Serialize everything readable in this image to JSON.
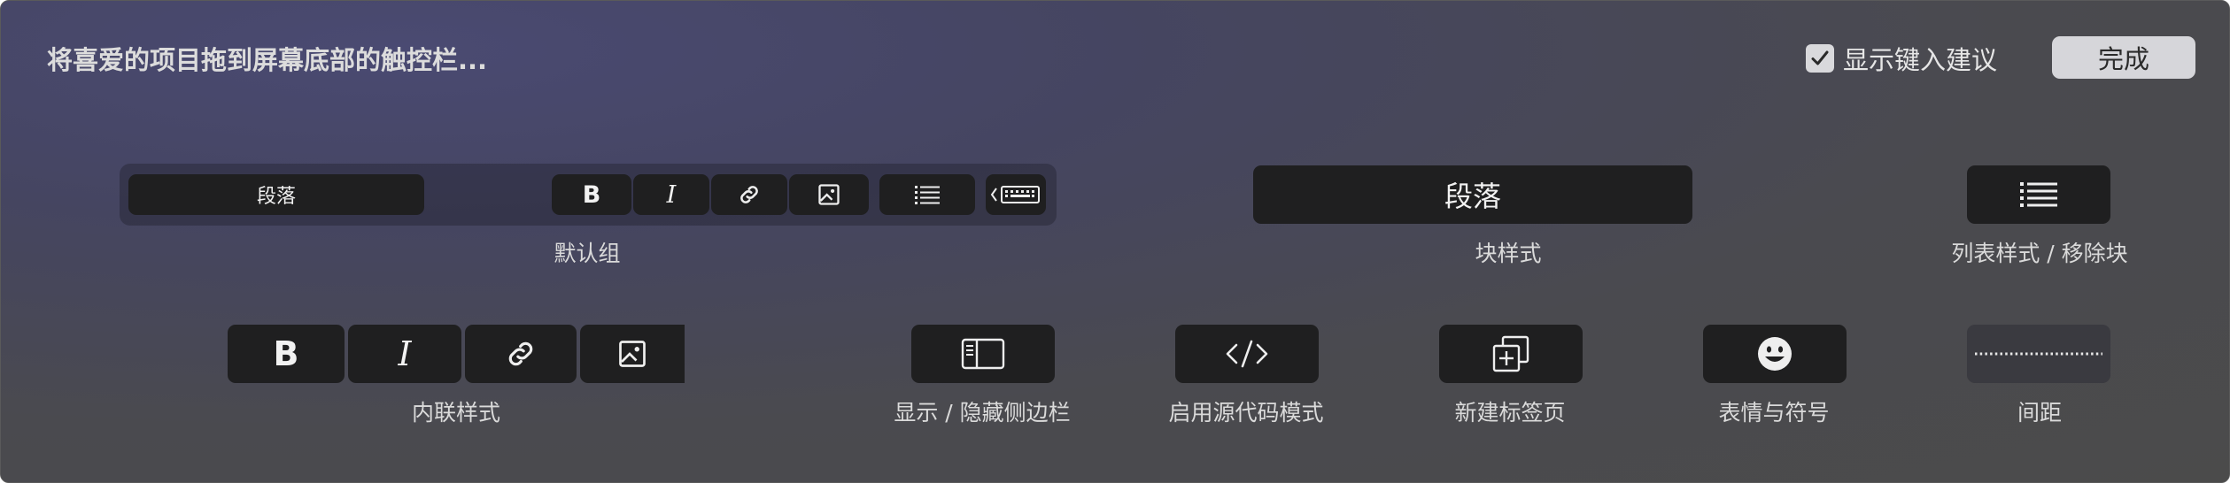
{
  "title": "将喜爱的项目拖到屏幕底部的触控栏...",
  "suggest": {
    "label": "显示键入建议",
    "checked": true
  },
  "done_label": "完成",
  "default_group": {
    "label": "默认组",
    "paragraph_key": "段落"
  },
  "items": {
    "block_style": {
      "label": "块样式",
      "key_text": "段落"
    },
    "list_style": {
      "label": "列表样式 / 移除块"
    },
    "inline_style": {
      "label": "内联样式",
      "bold": "B",
      "italic": "I"
    },
    "sidebar": {
      "label": "显示 / 隐藏侧边栏"
    },
    "source_mode": {
      "label": "启用源代码模式"
    },
    "new_tab": {
      "label": "新建标签页"
    },
    "emoji": {
      "label": "表情与符号"
    },
    "spacing": {
      "label": "间距"
    }
  },
  "default_group_keys": {
    "bold": "B",
    "italic": "I"
  }
}
